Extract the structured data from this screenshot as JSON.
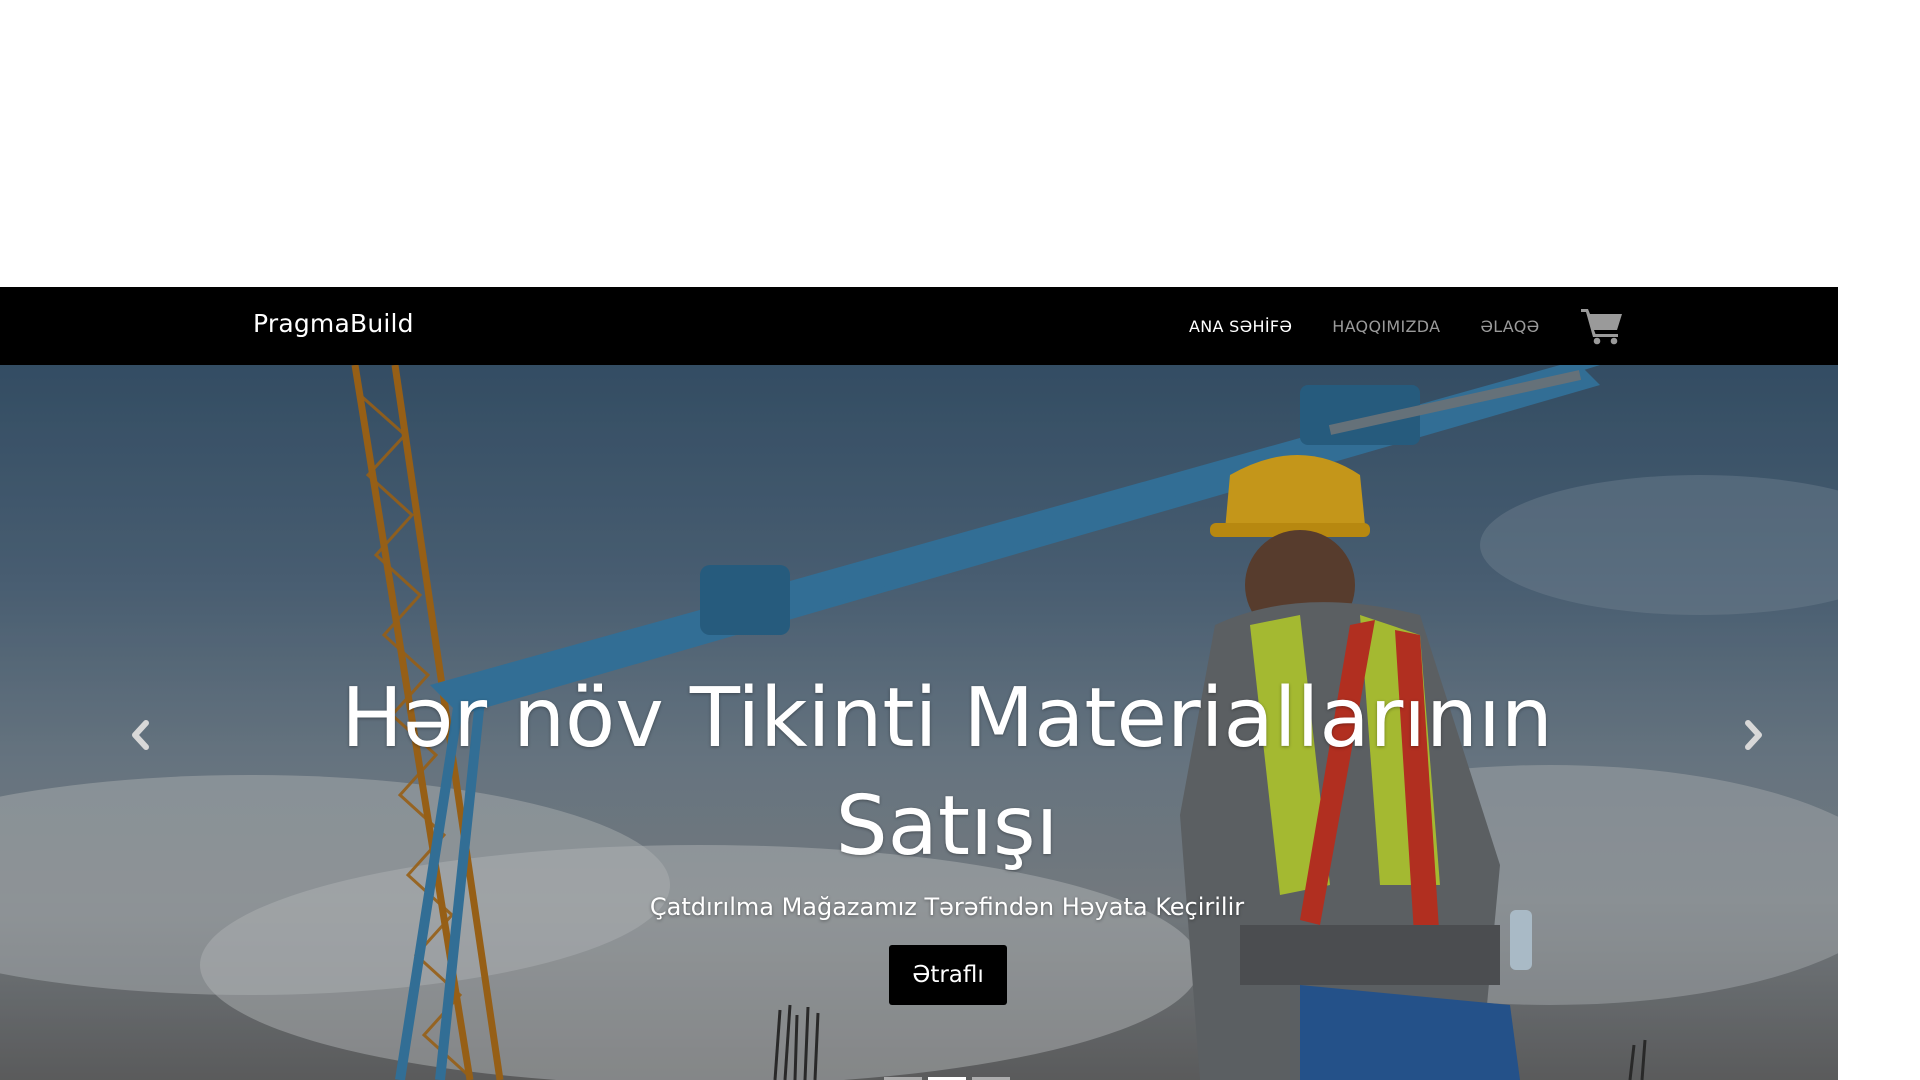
{
  "navbar": {
    "brand": "PragmaBuild",
    "links": [
      {
        "label": "ANA SƏHİFƏ",
        "active": true
      },
      {
        "label": "HAQQIMIZDA",
        "active": false
      },
      {
        "label": "ƏLAQƏ",
        "active": false
      }
    ],
    "cart_icon": "shopping-cart-icon"
  },
  "hero": {
    "title": "Hər növ Tikinti Materiallarının Satışı",
    "subtitle": "Çatdırılma Mağazamız Tərəfindən Həyata Keçirilir",
    "button_label": "Ətraflı",
    "prev_icon": "chevron-left-icon",
    "next_icon": "chevron-right-icon",
    "slide_count": 3,
    "active_slide": 2
  },
  "colors": {
    "navbar_bg": "#000000",
    "nav_active": "#ffffff",
    "nav_inactive": "#9a9a9a",
    "button_bg": "#000000"
  }
}
